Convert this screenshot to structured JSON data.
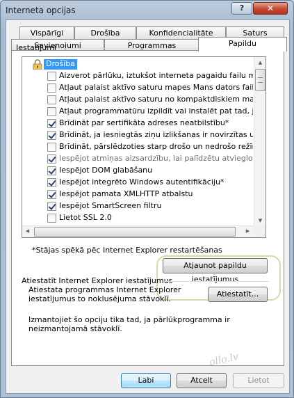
{
  "window": {
    "title": "Interneta opcijas",
    "help_label": "?",
    "close_label": "✕"
  },
  "tabs_back": [
    "Vispārīgi",
    "Drošība",
    "Konfidencialitāte",
    "Saturs"
  ],
  "tabs_front": [
    "Savienojumi",
    "Programmas",
    "Papildu"
  ],
  "active_tab": "Papildu",
  "settings": {
    "group_label": "Iestatījumi",
    "category": "Drošība",
    "items": [
      {
        "label": "Aizverot pārlūku, iztukšot interneta pagaidu failu mapi",
        "checked": false,
        "disabled": false
      },
      {
        "label": "Atļaut palaist aktīvo saturu mapes Mans dators failos*",
        "checked": false,
        "disabled": false
      },
      {
        "label": "Atļaut palaist aktīvo saturu no kompaktdiskiem mapē Mans",
        "checked": false,
        "disabled": false
      },
      {
        "label": "Atļaut programmatūru izpildīt vai instalēt pat tad, ja parak",
        "checked": false,
        "disabled": false
      },
      {
        "label": "Brīdināt par sertifikāta adreses neatbilstību*",
        "checked": true,
        "disabled": false
      },
      {
        "label": "Brīdināt, ja iesniegtās ziņu izlikšanas ir novirzītas uz zonu,",
        "checked": true,
        "disabled": false
      },
      {
        "label": "Brīdināt, pārslēdzoties starp drošo un nedrošo režīmu",
        "checked": false,
        "disabled": false
      },
      {
        "label": "Iespējot atmiņas aizsardzību, lai palīdzētu atvieglot tiešsai",
        "checked": true,
        "disabled": true
      },
      {
        "label": "Iespējot DOM glabāšanu",
        "checked": true,
        "disabled": false
      },
      {
        "label": "Iespējot integrēto Windows autentifikāciju*",
        "checked": true,
        "disabled": false
      },
      {
        "label": "Iespējot pamata XMLHTTP atbalstu",
        "checked": true,
        "disabled": false
      },
      {
        "label": "Iespējot SmartScreen filtru",
        "checked": true,
        "disabled": false
      },
      {
        "label": "Lietot SSL 2.0",
        "checked": false,
        "disabled": false
      }
    ],
    "restart_note": "*Stājas spēkā pēc Internet Explorer restartēšanas",
    "restore_button": "Atjaunot papildu iestatījumus"
  },
  "reset": {
    "label": "Atiestatīt Internet Explorer iestatījumus",
    "description": "Atiestata programmas Internet Explorer iestatījumus to noklusējuma stāvoklī.",
    "button": "Atiestatīt...",
    "note": "Izmantojiet šo opciju tika tad, ja pārlūkprogramma ir neizmantojamā stāvoklī."
  },
  "footer": {
    "ok": "Labi",
    "cancel": "Atcelt",
    "apply": "Lietot"
  },
  "watermark": "ollo.lv",
  "colors": {
    "selection": "#3399ff",
    "highlight_ring": "#ddd6a8"
  }
}
